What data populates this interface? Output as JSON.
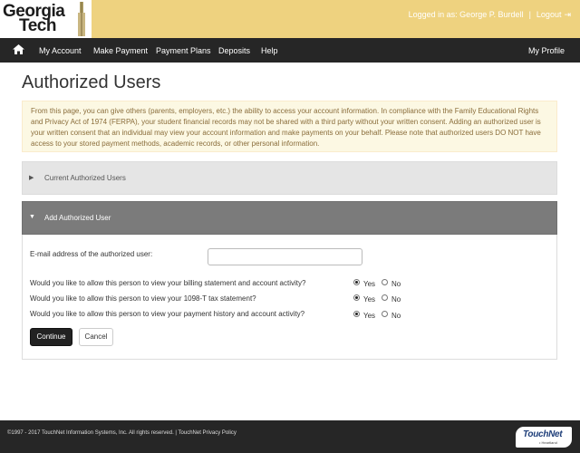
{
  "header": {
    "logo_line1": "Georgia",
    "logo_line2": "Tech",
    "logged_in_text": "Logged in as: George P. Burdell",
    "separator": "|",
    "logout_label": "Logout",
    "accent_color": "#eed27f"
  },
  "nav": {
    "home_icon": "home-icon",
    "items": [
      {
        "label": "My Account"
      },
      {
        "label": "Make Payment"
      },
      {
        "label": "Payment Plans"
      },
      {
        "label": "Deposits"
      },
      {
        "label": "Help"
      }
    ],
    "right_label": "My Profile"
  },
  "page": {
    "title": "Authorized Users",
    "notice": "From this page, you can give others (parents, employers, etc.) the ability to access your account information. In compliance with the Family Educational Rights and Privacy Act of 1974 (FERPA), your student financial records may not be shared with a third party without your written consent. Adding an authorized user is your written consent that an individual may view your account information and make payments on your behalf. Please note that authorized users DO NOT have access to your stored payment methods, academic records, or other personal information."
  },
  "panels": {
    "current": {
      "title": "Current Authorized Users",
      "caret": "▶"
    },
    "add": {
      "title": "Add Authorized User",
      "caret": "▼"
    }
  },
  "form": {
    "email_label": "E-mail address of the authorized user:",
    "email_value": "",
    "questions": [
      {
        "text": "Would you like to allow this person to view your billing statement and account activity?",
        "yes": "Yes",
        "no": "No",
        "selected": "Yes"
      },
      {
        "text": "Would you like to allow this person to view your 1098-T tax statement?",
        "yes": "Yes",
        "no": "No",
        "selected": "Yes"
      },
      {
        "text": "Would you like to allow this person to view your payment history and account activity?",
        "yes": "Yes",
        "no": "No",
        "selected": "Yes"
      }
    ],
    "continue_label": "Continue",
    "cancel_label": "Cancel"
  },
  "footer": {
    "copyright": "©1997 - 2017 TouchNet Information Systems, Inc. All rights reserved. | TouchNet Privacy Policy",
    "brand": "TouchNet",
    "brand_sub": "• Heartland"
  }
}
